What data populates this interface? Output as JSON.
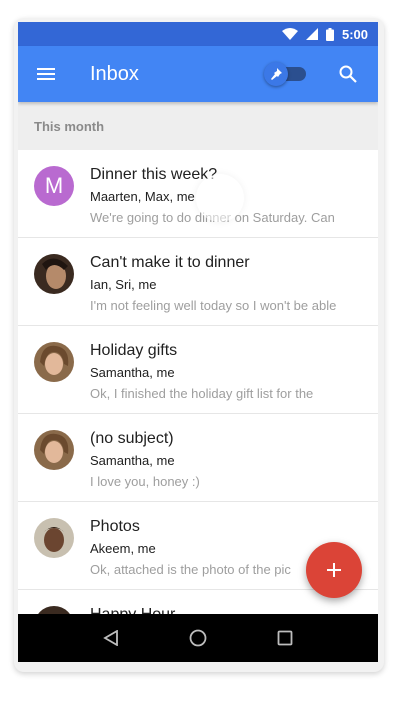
{
  "status_bar": {
    "time": "5:00"
  },
  "app_bar": {
    "title": "Inbox",
    "menu_icon": "menu-icon",
    "pin_icon": "pin-icon",
    "search_icon": "search-icon"
  },
  "section": {
    "label": "This month"
  },
  "emails": [
    {
      "subject": "Dinner this week?",
      "senders": "Maarten, Max, me",
      "snippet": "We're going to do dinner on Saturday. Can",
      "avatar": {
        "type": "letter",
        "letter": "M",
        "color": "#b96ad0"
      }
    },
    {
      "subject": "Can't make it to dinner",
      "senders": "Ian, Sri, me",
      "snippet": "I'm not feeling well today so I won't be able",
      "avatar": {
        "type": "photo"
      }
    },
    {
      "subject": "Holiday gifts",
      "senders": "Samantha, me",
      "snippet": "Ok, I finished the holiday gift list for the",
      "avatar": {
        "type": "photo"
      }
    },
    {
      "subject": "(no subject)",
      "senders": "Samantha, me",
      "snippet": "I love you, honey :)",
      "avatar": {
        "type": "photo"
      }
    },
    {
      "subject": "Photos",
      "senders": "Akeem, me",
      "snippet": "Ok, attached is the photo of the pic",
      "avatar": {
        "type": "photo"
      }
    },
    {
      "subject": "Happy Hour",
      "senders": "",
      "snippet": "",
      "avatar": {
        "type": "photo"
      }
    }
  ],
  "fab": {
    "icon": "plus-icon"
  },
  "nav": {
    "back": "back-icon",
    "home": "home-icon",
    "recents": "recents-icon"
  },
  "colors": {
    "primary": "#4285f4",
    "status": "#3367d6",
    "accent": "#db4437"
  }
}
